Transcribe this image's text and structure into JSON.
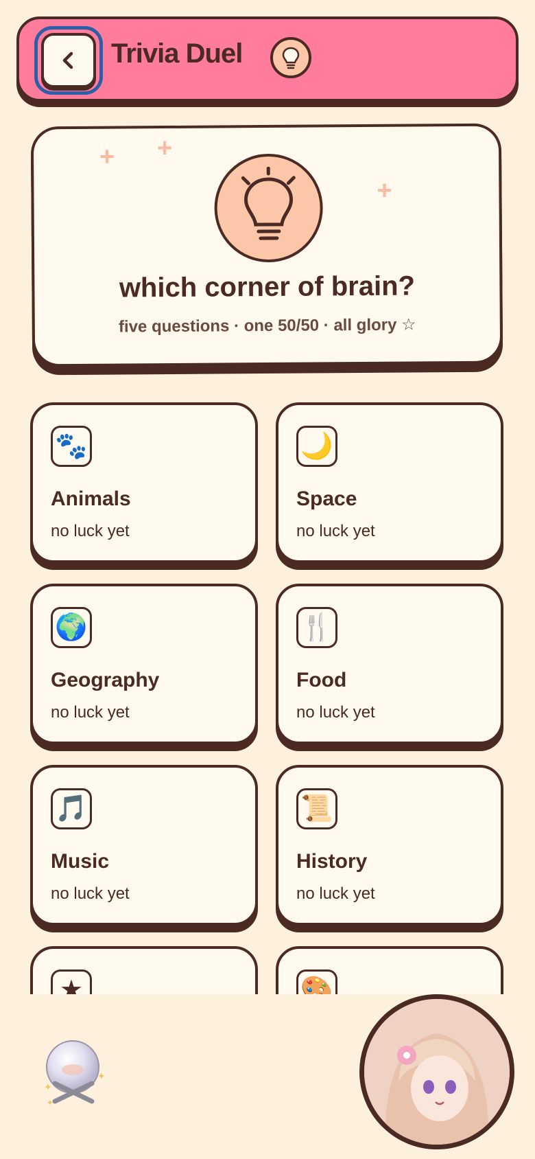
{
  "header": {
    "title": "Trivia Duel",
    "back_icon": "chevron-left-icon",
    "badge_icon": "lightbulb-icon"
  },
  "hero": {
    "heading": "which corner of brain?",
    "subtitle": "five questions · one 50/50 · all glory ☆",
    "icon": "lightbulb-icon"
  },
  "categories": [
    {
      "name": "Animals",
      "status": "no luck yet",
      "emoji": "🐾"
    },
    {
      "name": "Space",
      "status": "no luck yet",
      "emoji": "🌙"
    },
    {
      "name": "Geography",
      "status": "no luck yet",
      "emoji": "🌍"
    },
    {
      "name": "Food",
      "status": "no luck yet",
      "emoji": "🍴"
    },
    {
      "name": "Music",
      "status": "no luck yet",
      "emoji": "🎵"
    },
    {
      "name": "History",
      "status": "no luck yet",
      "emoji": "📜"
    },
    {
      "name": "",
      "status": "",
      "emoji": "★"
    },
    {
      "name": "",
      "status": "",
      "emoji": "🎨"
    }
  ],
  "colors": {
    "background": "#fdf1de",
    "header": "#ff7c9c",
    "card": "#fffaed",
    "outline": "#4a2a22",
    "accent": "#fbc7a8",
    "focus_ring": "#2f5ea8"
  }
}
